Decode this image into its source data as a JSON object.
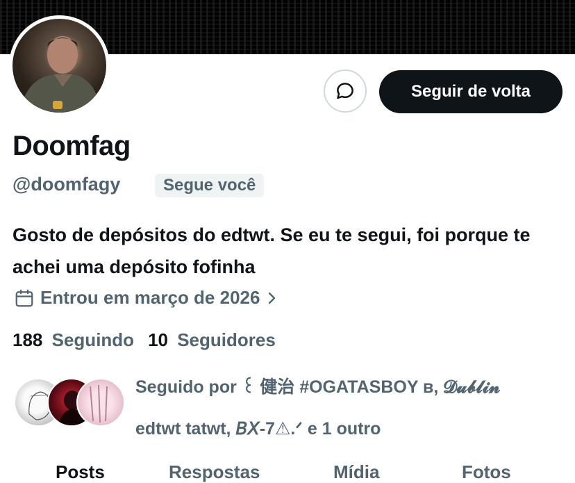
{
  "profile": {
    "name": "Doomfag",
    "handle": "@doomfagy",
    "follows_you_badge": "Segue você",
    "bio": "Gosto de depósitos do edtwt. Se eu te segui, foi porque te achei uma depósito fofinha",
    "joined": "Entrou em março de 2026"
  },
  "actions": {
    "follow_back": "Seguir de volta",
    "message_icon": "message-bubble-icon"
  },
  "stats": {
    "following_count": "188",
    "following_label": "Seguindo",
    "followers_count": "10",
    "followers_label": "Seguidores"
  },
  "followed_by": {
    "line1": "Seguido por ꒰ 健治 #OGATASBOY ʙ, 𝓓𝓾𝓫𝓵𝓲𝓷",
    "line2": "edtwt tatwt, 𝘉𝘟-7⚠.ᐟ e 1 outro"
  },
  "tabs": [
    "Posts",
    "Respostas",
    "Mídia",
    "Fotos"
  ],
  "colors": {
    "text": "#0f1419",
    "secondary": "#536471",
    "button_bg": "#0f1419",
    "badge_bg": "#eff3f4",
    "border": "#cfd9de"
  }
}
